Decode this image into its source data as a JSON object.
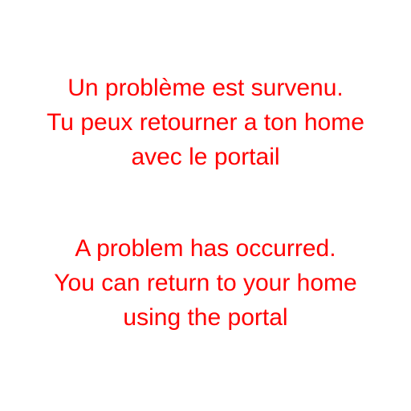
{
  "messages": {
    "french": {
      "lines": [
        "Un problème est survenu.",
        "Tu peux retourner a ton home",
        "avec le portail"
      ]
    },
    "english": {
      "lines": [
        "A problem has occurred.",
        "You can return to your home",
        "using the portal"
      ]
    }
  },
  "colors": {
    "text": "#ff0000",
    "background": "#ffffff"
  }
}
